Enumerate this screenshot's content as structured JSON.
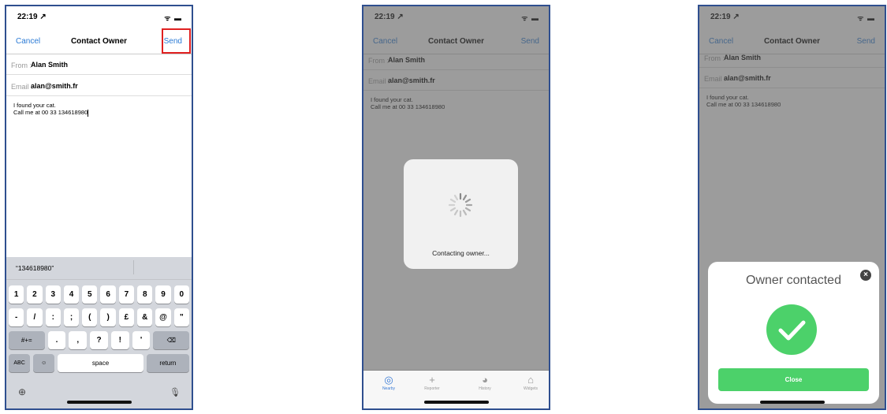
{
  "status": {
    "time": "22:19",
    "time_suffix": " ↗",
    "icons": "ᯤ ▬"
  },
  "compose": {
    "cancel": "Cancel",
    "title": "Contact Owner",
    "send": "Send",
    "from_label": "From :",
    "from_value": "Alan Smith",
    "email_label": "Email :",
    "email_value": "alan@smith.fr",
    "message_line1": "I found your cat.",
    "message_line2": "Call me at 00 33 134618980"
  },
  "keyboard": {
    "suggestion": "“134618980”",
    "row1": [
      "1",
      "2",
      "3",
      "4",
      "5",
      "6",
      "7",
      "8",
      "9",
      "0"
    ],
    "row2": [
      "-",
      "/",
      ":",
      ";",
      "(",
      ")",
      "£",
      "&",
      "@",
      "\""
    ],
    "row3_left": "#+=",
    "row3": [
      ".",
      ",",
      "?",
      "!",
      "'"
    ],
    "row3_right": "⌫",
    "abc": "ABC",
    "emoji": "☺",
    "space": "space",
    "return": "return",
    "globe": "⊕",
    "mic": "🎙"
  },
  "loading": {
    "text": "Contacting owner..."
  },
  "tabs": [
    {
      "label": "Nearby",
      "icon": "◎"
    },
    {
      "label": "Reporter",
      "icon": "+"
    },
    {
      "label": "History",
      "icon": "◕"
    },
    {
      "label": "Widgets",
      "icon": "⌂"
    }
  ],
  "success": {
    "title": "Owner contacted",
    "close_icon": "×",
    "close_label": "Close"
  },
  "colors": {
    "accent": "#2a7ad5",
    "success": "#4cd16a",
    "highlight": "#e02020"
  }
}
